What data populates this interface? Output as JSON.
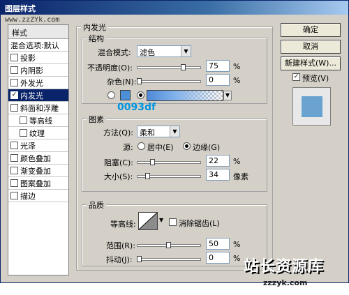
{
  "window": {
    "title": "图层样式"
  },
  "watermark": "www.zzZYk.com",
  "left_panel": {
    "header": "样式",
    "blend_defaults": "混合选项:默认",
    "items": [
      {
        "label": "投影",
        "checked": false,
        "selected": false,
        "sub": false
      },
      {
        "label": "内阴影",
        "checked": false,
        "selected": false,
        "sub": false
      },
      {
        "label": "外发光",
        "checked": false,
        "selected": false,
        "sub": false
      },
      {
        "label": "内发光",
        "checked": true,
        "selected": true,
        "sub": false
      },
      {
        "label": "斜面和浮雕",
        "checked": false,
        "selected": false,
        "sub": false
      },
      {
        "label": "等高线",
        "checked": false,
        "selected": false,
        "sub": true
      },
      {
        "label": "纹理",
        "checked": false,
        "selected": false,
        "sub": true
      },
      {
        "label": "光泽",
        "checked": false,
        "selected": false,
        "sub": false
      },
      {
        "label": "颜色叠加",
        "checked": false,
        "selected": false,
        "sub": false
      },
      {
        "label": "渐变叠加",
        "checked": false,
        "selected": false,
        "sub": false
      },
      {
        "label": "图案叠加",
        "checked": false,
        "selected": false,
        "sub": false
      },
      {
        "label": "描边",
        "checked": false,
        "selected": false,
        "sub": false
      }
    ]
  },
  "inner_glow": {
    "title": "内发光",
    "structure": {
      "title": "结构",
      "blend_mode_label": "混合模式:",
      "blend_mode_value": "滤色",
      "opacity_label": "不透明度(O):",
      "opacity_value": "75",
      "opacity_unit": "%",
      "noise_label": "杂色(N):",
      "noise_value": "0",
      "noise_unit": "%",
      "color_swatch": "#4b8fd6",
      "hex_annotation": "0093df"
    },
    "elements": {
      "title": "图素",
      "method_label": "方法(Q):",
      "method_value": "柔和",
      "source_label": "源:",
      "source_center": "居中(E)",
      "source_edge": "边缘(G)",
      "choke_label": "阻塞(C):",
      "choke_value": "22",
      "choke_unit": "%",
      "size_label": "大小(S):",
      "size_value": "34",
      "size_unit": "像素"
    },
    "quality": {
      "title": "品质",
      "contour_label": "等高线:",
      "antialias_label": "消除锯齿(L)",
      "range_label": "范围(R):",
      "range_value": "50",
      "range_unit": "%",
      "jitter_label": "抖动(J):",
      "jitter_value": "0",
      "jitter_unit": "%"
    }
  },
  "buttons": {
    "ok": "确定",
    "cancel": "取消",
    "new_style": "新建样式(W)...",
    "preview": "预览(V)"
  },
  "logo": {
    "main": "站长资源库",
    "sub": "zzzyk.com"
  }
}
